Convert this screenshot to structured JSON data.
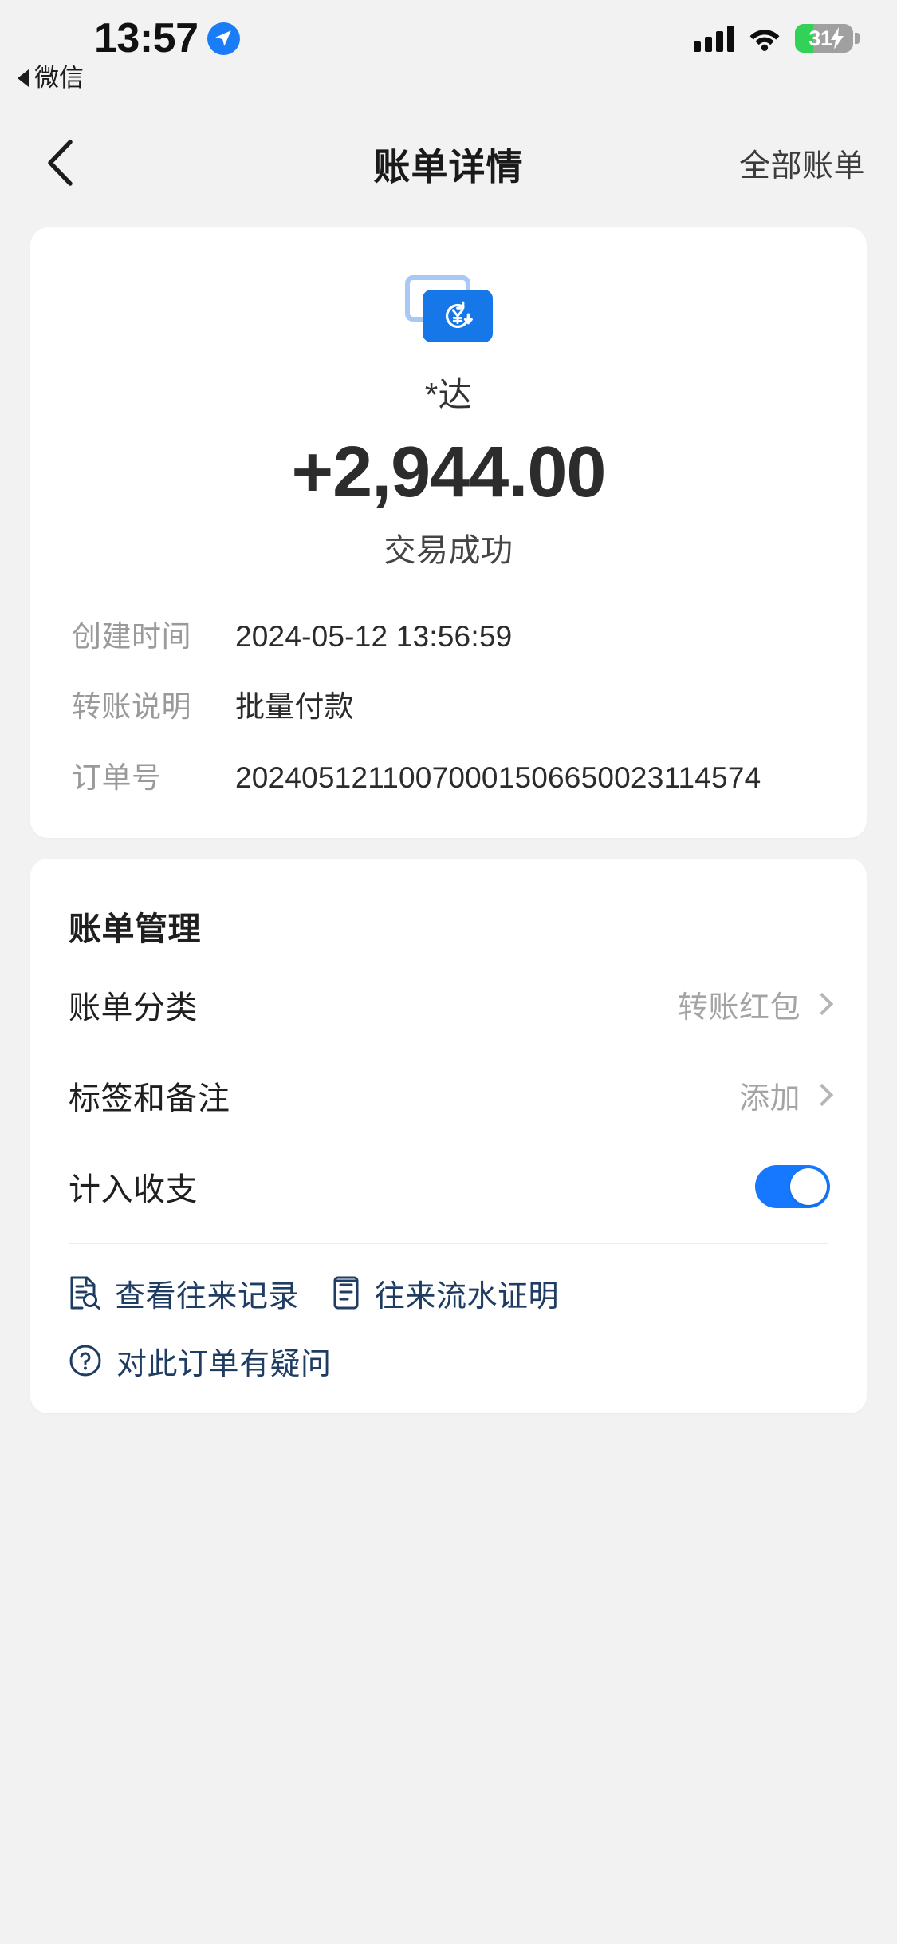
{
  "status_bar": {
    "time": "13:57",
    "location_icon": "location-arrow-icon",
    "back_app_label": "微信",
    "signal_icon": "cellular-signal-icon",
    "wifi_icon": "wifi-icon",
    "battery_percent": "31",
    "battery_level": 31,
    "battery_charging_icon": "charging-bolt-icon"
  },
  "nav": {
    "back_icon": "chevron-left-icon",
    "title": "账单详情",
    "action_label": "全部账单"
  },
  "detail": {
    "icon_name": "transfer-red-packet-icon",
    "payee": "*达",
    "amount": "+2,944.00",
    "status": "交易成功",
    "rows": [
      {
        "label": "创建时间",
        "value": "2024-05-12 13:56:59"
      },
      {
        "label": "转账说明",
        "value": "批量付款"
      },
      {
        "label": "订单号",
        "value": "20240512110070001506650023114574"
      }
    ]
  },
  "manage": {
    "section_title": "账单管理",
    "category": {
      "label": "账单分类",
      "value": "转账红包"
    },
    "tags": {
      "label": "标签和备注",
      "value": "添加"
    },
    "include": {
      "label": "计入收支",
      "toggle_on": true
    },
    "links": [
      {
        "icon": "document-search-icon",
        "text": "查看往来记录"
      },
      {
        "icon": "document-list-icon",
        "text": "往来流水证明"
      },
      {
        "icon": "question-circle-icon",
        "text": "对此订单有疑问"
      }
    ]
  },
  "colors": {
    "accent_blue": "#1677ff",
    "icon_blue": "#1677e8",
    "link_navy": "#1f3c63",
    "battery_green": "#32d158",
    "page_bg": "#f2f2f2"
  }
}
